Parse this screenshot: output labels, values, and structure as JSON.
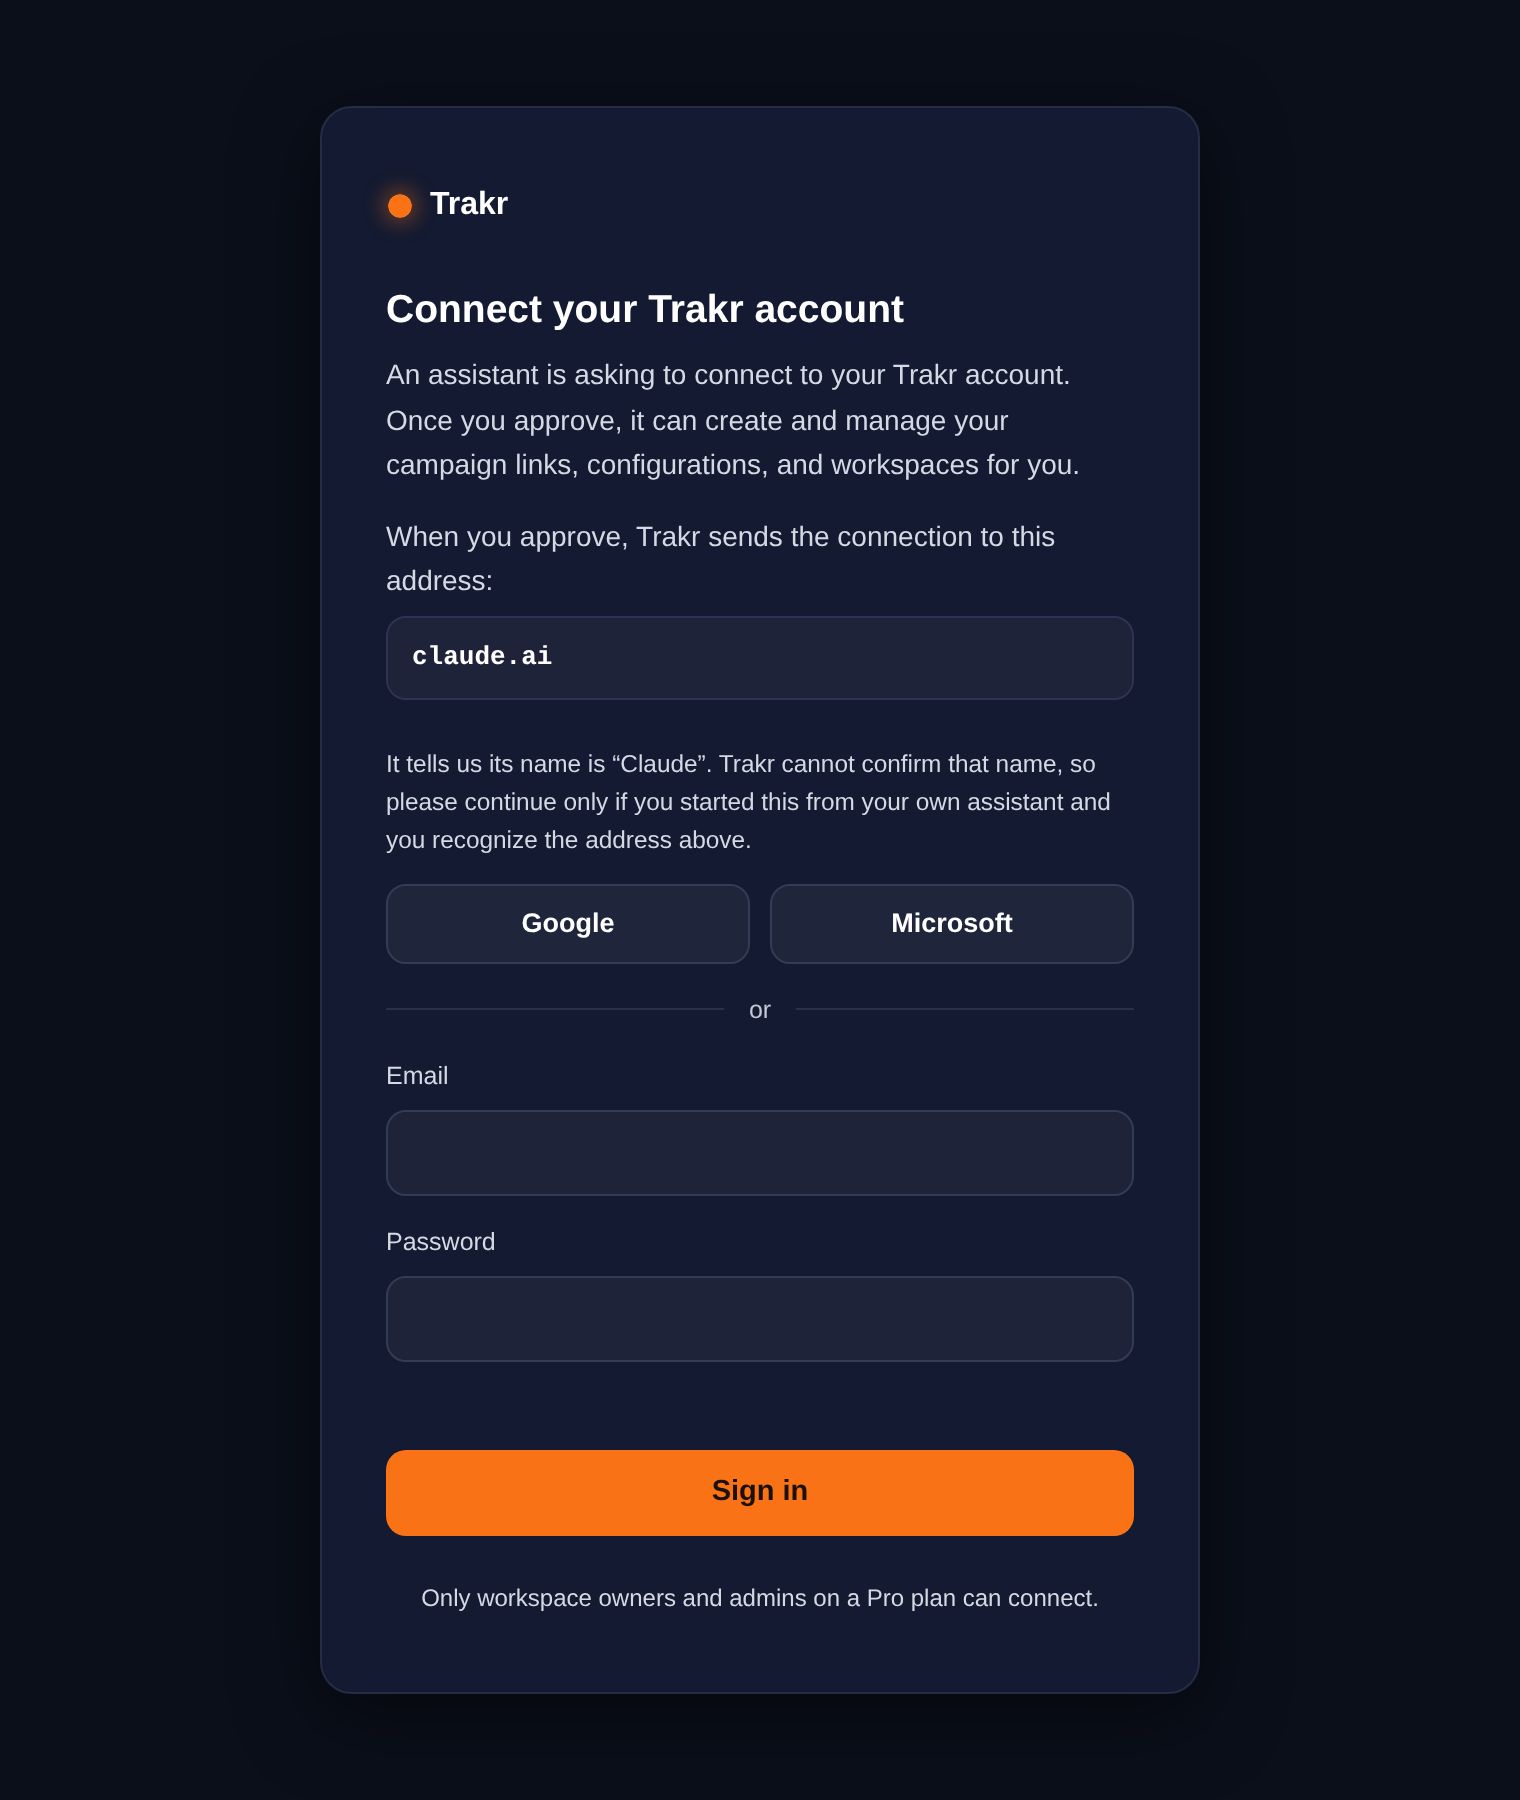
{
  "brand": {
    "name": "Trakr"
  },
  "heading": "Connect your Trakr account",
  "intro": "An assistant is asking to connect to your Trakr account. Once you approve, it can create and manage your campaign links, configurations, and workspaces for you.",
  "address_prompt": "When you approve, Trakr sends the connection to this address:",
  "address": "claude.ai",
  "warning": "It tells us its name is “Claude”. Trakr cannot confirm that name, so please continue only if you started this from your own assistant and you recognize the address above.",
  "providers": [
    "Google",
    "Microsoft"
  ],
  "divider": "or",
  "fields": [
    {
      "label": "Email"
    },
    {
      "label": "Password"
    }
  ],
  "submit": "Sign in",
  "footer": "Only workspace owners and admins on a Pro plan can connect."
}
